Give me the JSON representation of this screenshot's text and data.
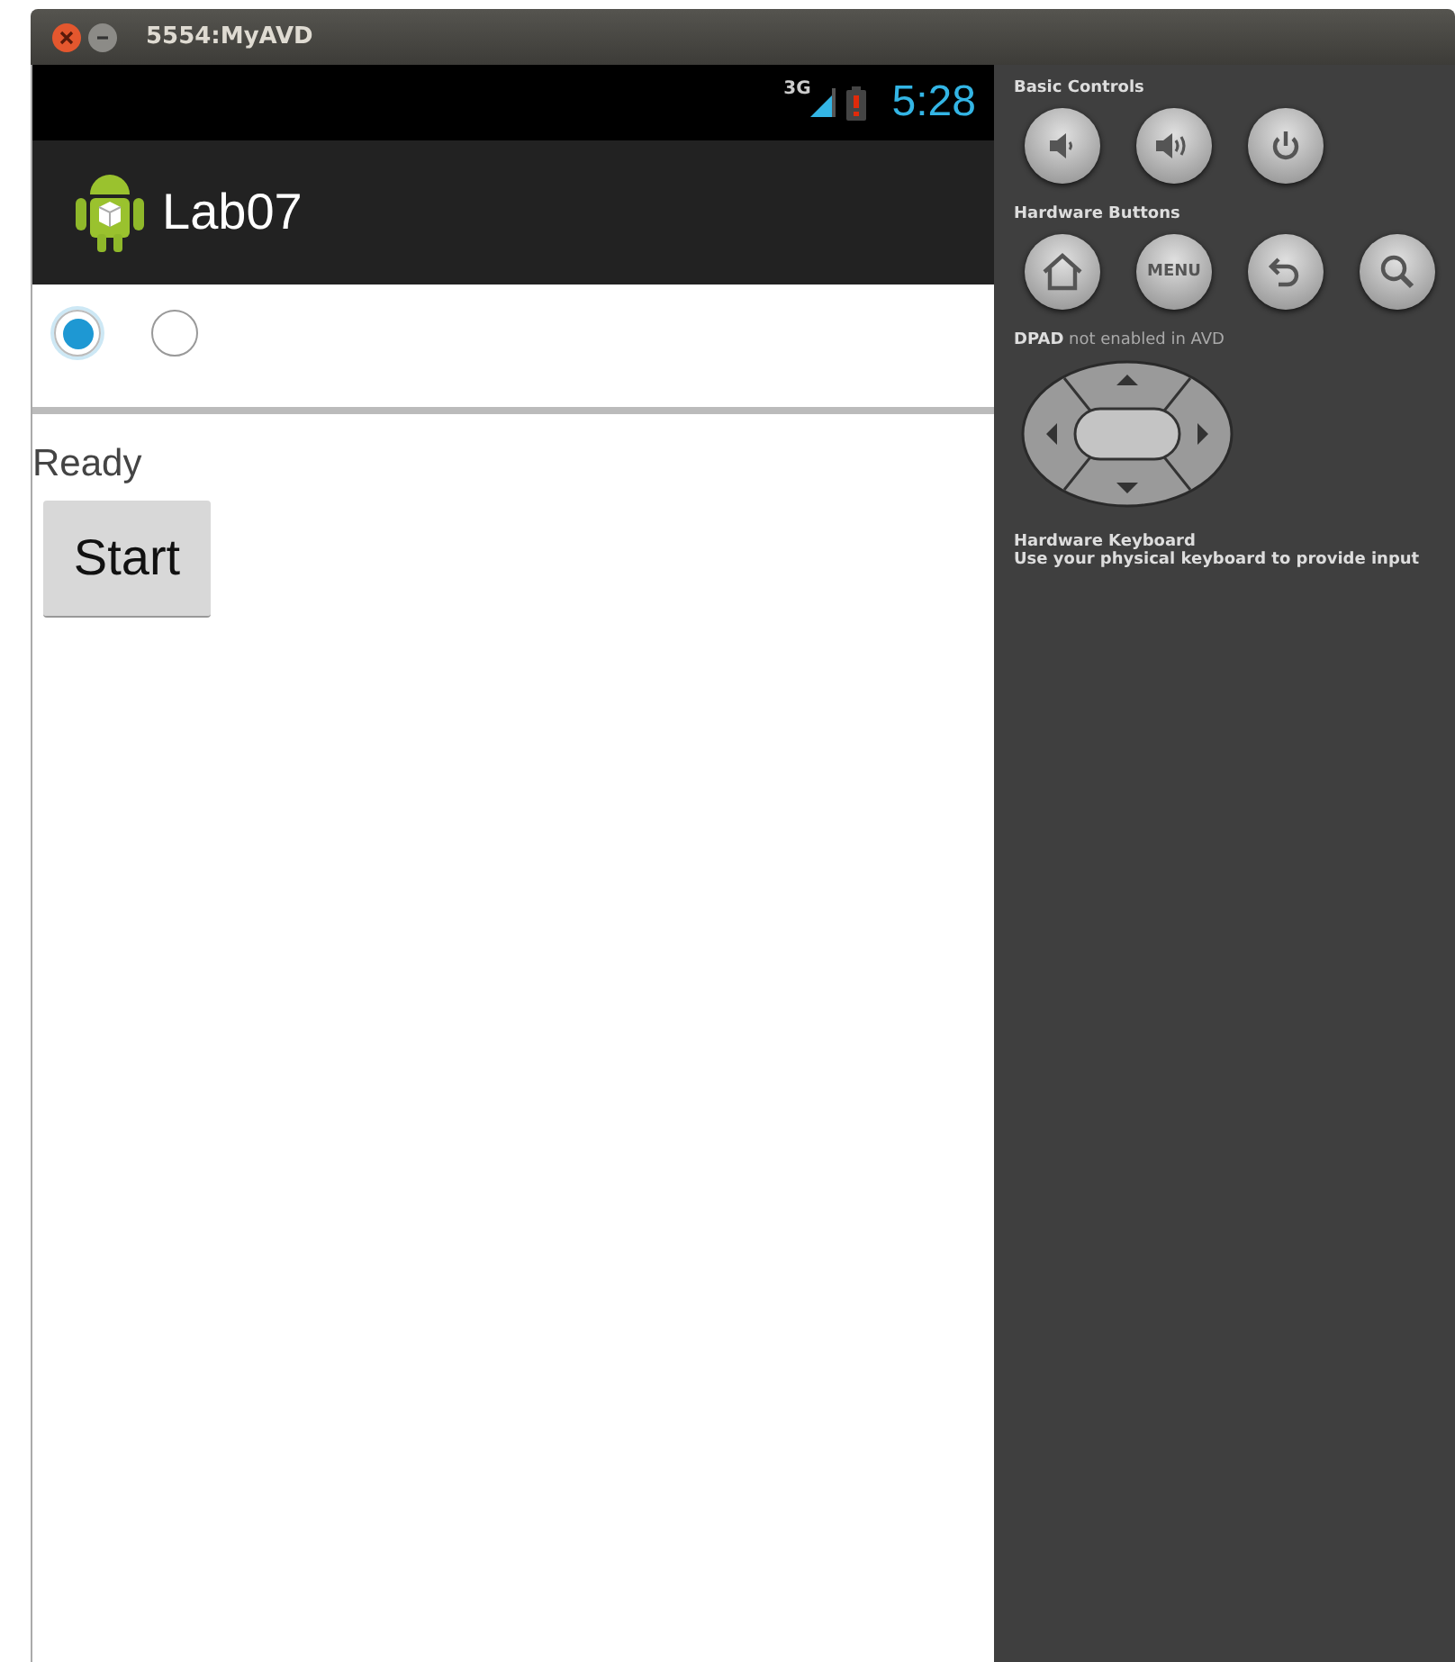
{
  "window": {
    "title": "5554:MyAVD"
  },
  "status_bar": {
    "network": "3G",
    "time": "5:28"
  },
  "action_bar": {
    "title": "Lab07"
  },
  "radios": [
    {
      "selected": true
    },
    {
      "selected": false
    }
  ],
  "status_text": "Ready",
  "start_button": "Start",
  "controls": {
    "basic_title": "Basic Controls",
    "hardware_title": "Hardware Buttons",
    "hardware_buttons": [
      {
        "kind": "home"
      },
      {
        "kind": "menu",
        "label": "MENU"
      },
      {
        "kind": "back"
      },
      {
        "kind": "search"
      }
    ],
    "dpad_note": "**DPAD** not enabled in AVD",
    "keyboard_title": "Hardware Keyboard",
    "keyboard_note": "Use your physical keyboard to provide input"
  }
}
